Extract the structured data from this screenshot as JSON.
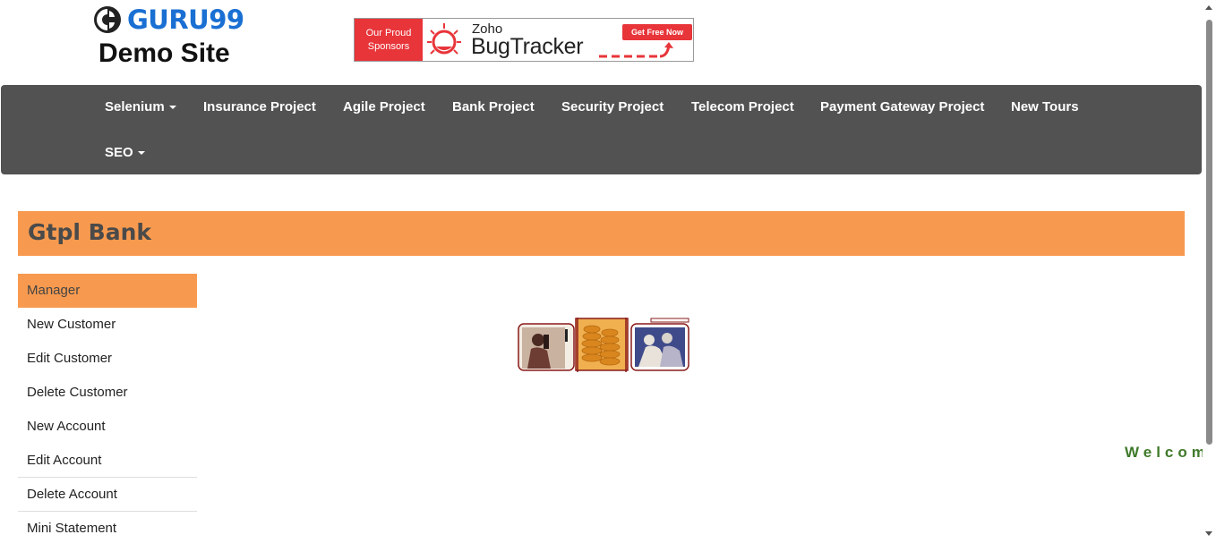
{
  "logo": {
    "brand": "GURU99",
    "subtitle": "Demo Site",
    "icon": "guru99-logo-icon"
  },
  "banner": {
    "sponsor_line1": "Our Proud",
    "sponsor_line2": "Sponsors",
    "vendor": "Zoho",
    "product": "BugTracker",
    "cta": "Get Free Now",
    "icon": "bug-icon"
  },
  "nav": {
    "items": [
      {
        "label": "Selenium",
        "dropdown": true
      },
      {
        "label": "Insurance Project",
        "dropdown": false
      },
      {
        "label": "Agile Project",
        "dropdown": false
      },
      {
        "label": "Bank Project",
        "dropdown": false
      },
      {
        "label": "Security Project",
        "dropdown": false
      },
      {
        "label": "Telecom Project",
        "dropdown": false
      },
      {
        "label": "Payment Gateway Project",
        "dropdown": false
      },
      {
        "label": "New Tours",
        "dropdown": false
      },
      {
        "label": "SEO",
        "dropdown": true
      }
    ]
  },
  "page": {
    "title": "Gtpl Bank"
  },
  "menu": {
    "items": [
      {
        "label": "Manager",
        "active": true
      },
      {
        "label": "New Customer"
      },
      {
        "label": "Edit Customer"
      },
      {
        "label": "Delete Customer"
      },
      {
        "label": "New Account"
      },
      {
        "label": "Edit Account"
      },
      {
        "label": "Delete Account"
      },
      {
        "label": "Mini Statement"
      }
    ]
  },
  "main": {
    "welcome_text": "Welcom"
  },
  "colors": {
    "navbar": "#525252",
    "accent": "#f79a4f",
    "brand_blue": "#1a6fd3",
    "sponsor_red": "#e8353a",
    "welcome_green": "#3f7a2a"
  }
}
